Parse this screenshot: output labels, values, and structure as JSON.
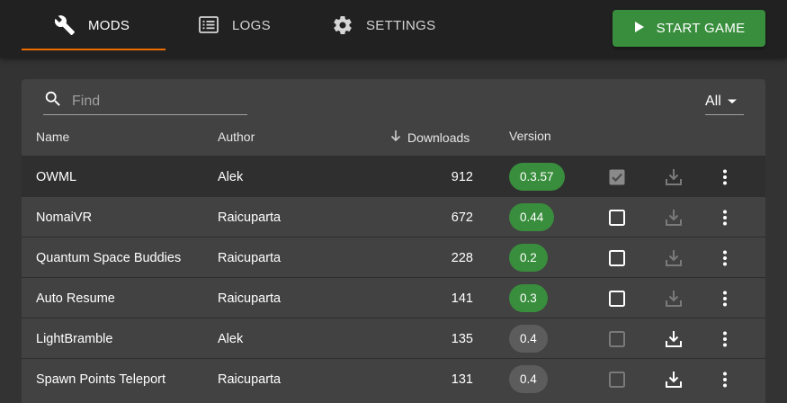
{
  "nav": {
    "tabs": [
      {
        "label": "MODS",
        "icon": "wrench-icon",
        "active": true
      },
      {
        "label": "LOGS",
        "icon": "logs-list-icon",
        "active": false
      },
      {
        "label": "SETTINGS",
        "icon": "gear-icon",
        "active": false
      }
    ],
    "start_button": "START GAME"
  },
  "toolbar": {
    "search_placeholder": "Find",
    "search_value": "",
    "filter_value": "All"
  },
  "table": {
    "columns": {
      "name": "Name",
      "author": "Author",
      "downloads": "Downloads",
      "version": "Version"
    },
    "rows": [
      {
        "name": "OWML",
        "author": "Alek",
        "downloads": "912",
        "version": "0.3.57",
        "installed": true,
        "enabled": true,
        "checkbox_disabled": true,
        "download_available": false,
        "version_color": "#388e3c"
      },
      {
        "name": "NomaiVR",
        "author": "Raicuparta",
        "downloads": "672",
        "version": "0.44",
        "installed": true,
        "enabled": false,
        "checkbox_disabled": false,
        "download_available": false,
        "version_color": "#388e3c"
      },
      {
        "name": "Quantum Space Buddies",
        "author": "Raicuparta",
        "downloads": "228",
        "version": "0.2",
        "installed": true,
        "enabled": false,
        "checkbox_disabled": false,
        "download_available": false,
        "version_color": "#388e3c"
      },
      {
        "name": "Auto Resume",
        "author": "Raicuparta",
        "downloads": "141",
        "version": "0.3",
        "installed": true,
        "enabled": false,
        "checkbox_disabled": false,
        "download_available": false,
        "version_color": "#388e3c"
      },
      {
        "name": "LightBramble",
        "author": "Alek",
        "downloads": "135",
        "version": "0.4",
        "installed": false,
        "enabled": false,
        "checkbox_disabled": true,
        "download_available": true,
        "version_color": "#5c5c5c"
      },
      {
        "name": "Spawn Points Teleport",
        "author": "Raicuparta",
        "downloads": "131",
        "version": "0.4",
        "installed": false,
        "enabled": false,
        "checkbox_disabled": true,
        "download_available": true,
        "version_color": "#5c5c5c"
      }
    ]
  },
  "colors": {
    "accent_orange": "#ef6c00",
    "primary_green": "#388e3c",
    "topbar_bg": "#212121",
    "panel_bg": "#424242"
  }
}
